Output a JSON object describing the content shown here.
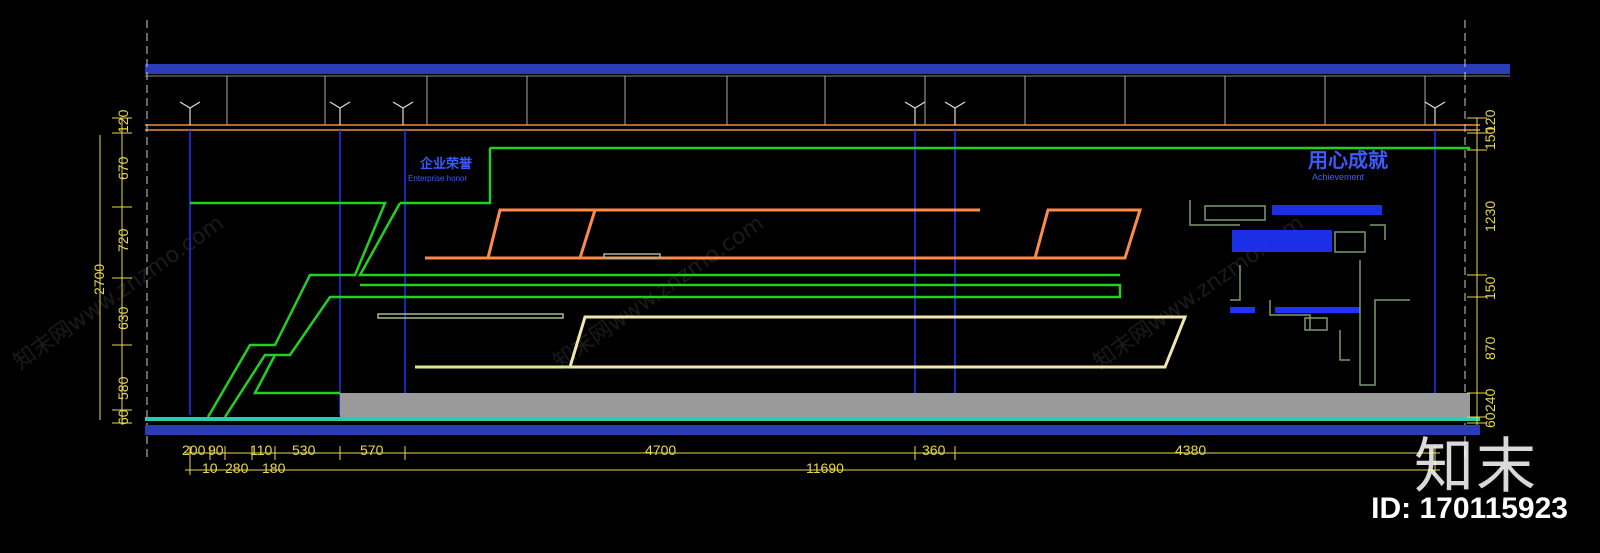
{
  "labels": {
    "left_title_cn": "企业荣誉",
    "left_title_en": "Enterprise honor",
    "right_title_cn": "用心成就",
    "right_title_en": "Achievement"
  },
  "dims_bottom_row1": [
    "200",
    "90",
    "110",
    "530",
    "570",
    "4700",
    "360",
    "4380"
  ],
  "dims_bottom_row2": [
    "10",
    "280",
    "180"
  ],
  "dim_total": "11690",
  "dims_left": [
    "120",
    "670",
    "720",
    "2700",
    "630",
    "580",
    "60"
  ],
  "dims_right": [
    "120",
    "150",
    "1230",
    "150",
    "870",
    "240",
    "60"
  ],
  "watermarks": [
    "知末网www.znzmo.com"
  ],
  "branding": {
    "logo": "知末",
    "id": "ID: 170115923"
  },
  "colors": {
    "green": "#22d022",
    "orange": "#ff8a4a",
    "blue": "#1d34ff",
    "yellow": "#e8d84a",
    "gray": "#9a9a9a"
  }
}
